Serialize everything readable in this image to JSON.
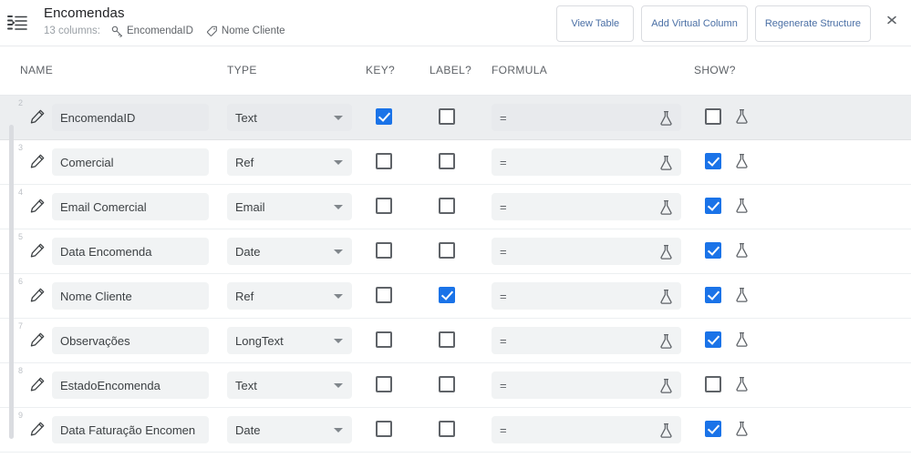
{
  "header": {
    "menu_icon": "hamburger-menu-icon",
    "title": "Encomendas",
    "column_count_label": "13 columns:",
    "key_chip": {
      "icon": "key-icon",
      "label": "EncomendaID"
    },
    "label_chip": {
      "icon": "tag-icon",
      "label": "Nome Cliente"
    },
    "buttons": [
      {
        "label": "View Table",
        "name": "view-table-button"
      },
      {
        "label": "Add Virtual Column",
        "name": "add-virtual-column-button"
      },
      {
        "label": "Regenerate Structure",
        "name": "regenerate-structure-button"
      }
    ],
    "collapse_icon": "collapse-expand-icon"
  },
  "table": {
    "columns": {
      "name": "NAME",
      "type": "TYPE",
      "key": "KEY?",
      "label": "LABEL?",
      "formula": "FORMULA",
      "show": "SHOW?"
    },
    "formula_prefix": "=",
    "rows": [
      {
        "num": "2",
        "name": "EncomendaID",
        "type": "Text",
        "key": true,
        "label": false,
        "formula": "",
        "show": false,
        "selected": true
      },
      {
        "num": "3",
        "name": "Comercial",
        "type": "Ref",
        "key": false,
        "label": false,
        "formula": "",
        "show": true,
        "selected": false
      },
      {
        "num": "4",
        "name": "Email Comercial",
        "type": "Email",
        "key": false,
        "label": false,
        "formula": "",
        "show": true,
        "selected": false
      },
      {
        "num": "5",
        "name": "Data Encomenda",
        "type": "Date",
        "key": false,
        "label": false,
        "formula": "",
        "show": true,
        "selected": false
      },
      {
        "num": "6",
        "name": "Nome Cliente",
        "type": "Ref",
        "key": false,
        "label": true,
        "formula": "",
        "show": true,
        "selected": false
      },
      {
        "num": "7",
        "name": "Observações",
        "type": "LongText",
        "key": false,
        "label": false,
        "formula": "",
        "show": true,
        "selected": false
      },
      {
        "num": "8",
        "name": "EstadoEncomenda",
        "type": "Text",
        "key": false,
        "label": false,
        "formula": "",
        "show": false,
        "selected": false
      },
      {
        "num": "9",
        "name": "Data Faturação Encomen",
        "type": "Date",
        "key": false,
        "label": false,
        "formula": "",
        "show": true,
        "selected": false
      }
    ]
  },
  "colors": {
    "accent": "#1a73e8",
    "button_text": "#4a6fa5",
    "field_bg": "#f1f3f4",
    "selected_row_bg": "#eceef0",
    "text_primary": "#202124",
    "text_secondary": "#5f6368"
  }
}
